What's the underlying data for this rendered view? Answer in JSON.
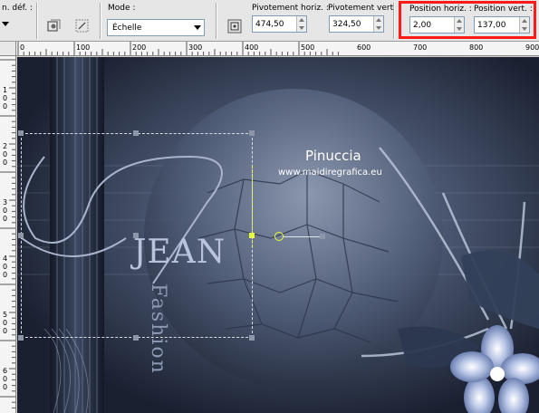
{
  "toolbar": {
    "preset_label": "n. déf. :",
    "mode_label": "Mode :",
    "mode_value": "Échelle",
    "rot_h_label": "Pivotement horiz. :",
    "rot_h_value": "474,50",
    "rot_v_label": "Pivotement vert. :",
    "rot_v_value": "324,50",
    "pos_h_label": "Position horiz. :",
    "pos_h_value": "2,00",
    "pos_v_label": "Position vert. :",
    "pos_v_value": "137,00",
    "highlight_color": "#ff1a1a"
  },
  "rulers": {
    "h_ticks": [
      "0",
      "100",
      "200",
      "300",
      "400",
      "500",
      "600",
      "700",
      "800",
      "900"
    ],
    "v_ticks": [
      "1\n0\n0",
      "2\n0\n0",
      "3\n0\n0",
      "4\n0\n0",
      "5\n0\n0",
      "6\n0\n0"
    ]
  },
  "canvas": {
    "watermark_name": "Pinuccia",
    "watermark_url": "www.maidiregrafica.eu",
    "deco_letters": "JEAN",
    "deco_word": "Fashion",
    "bg_color": "#1b2130"
  }
}
